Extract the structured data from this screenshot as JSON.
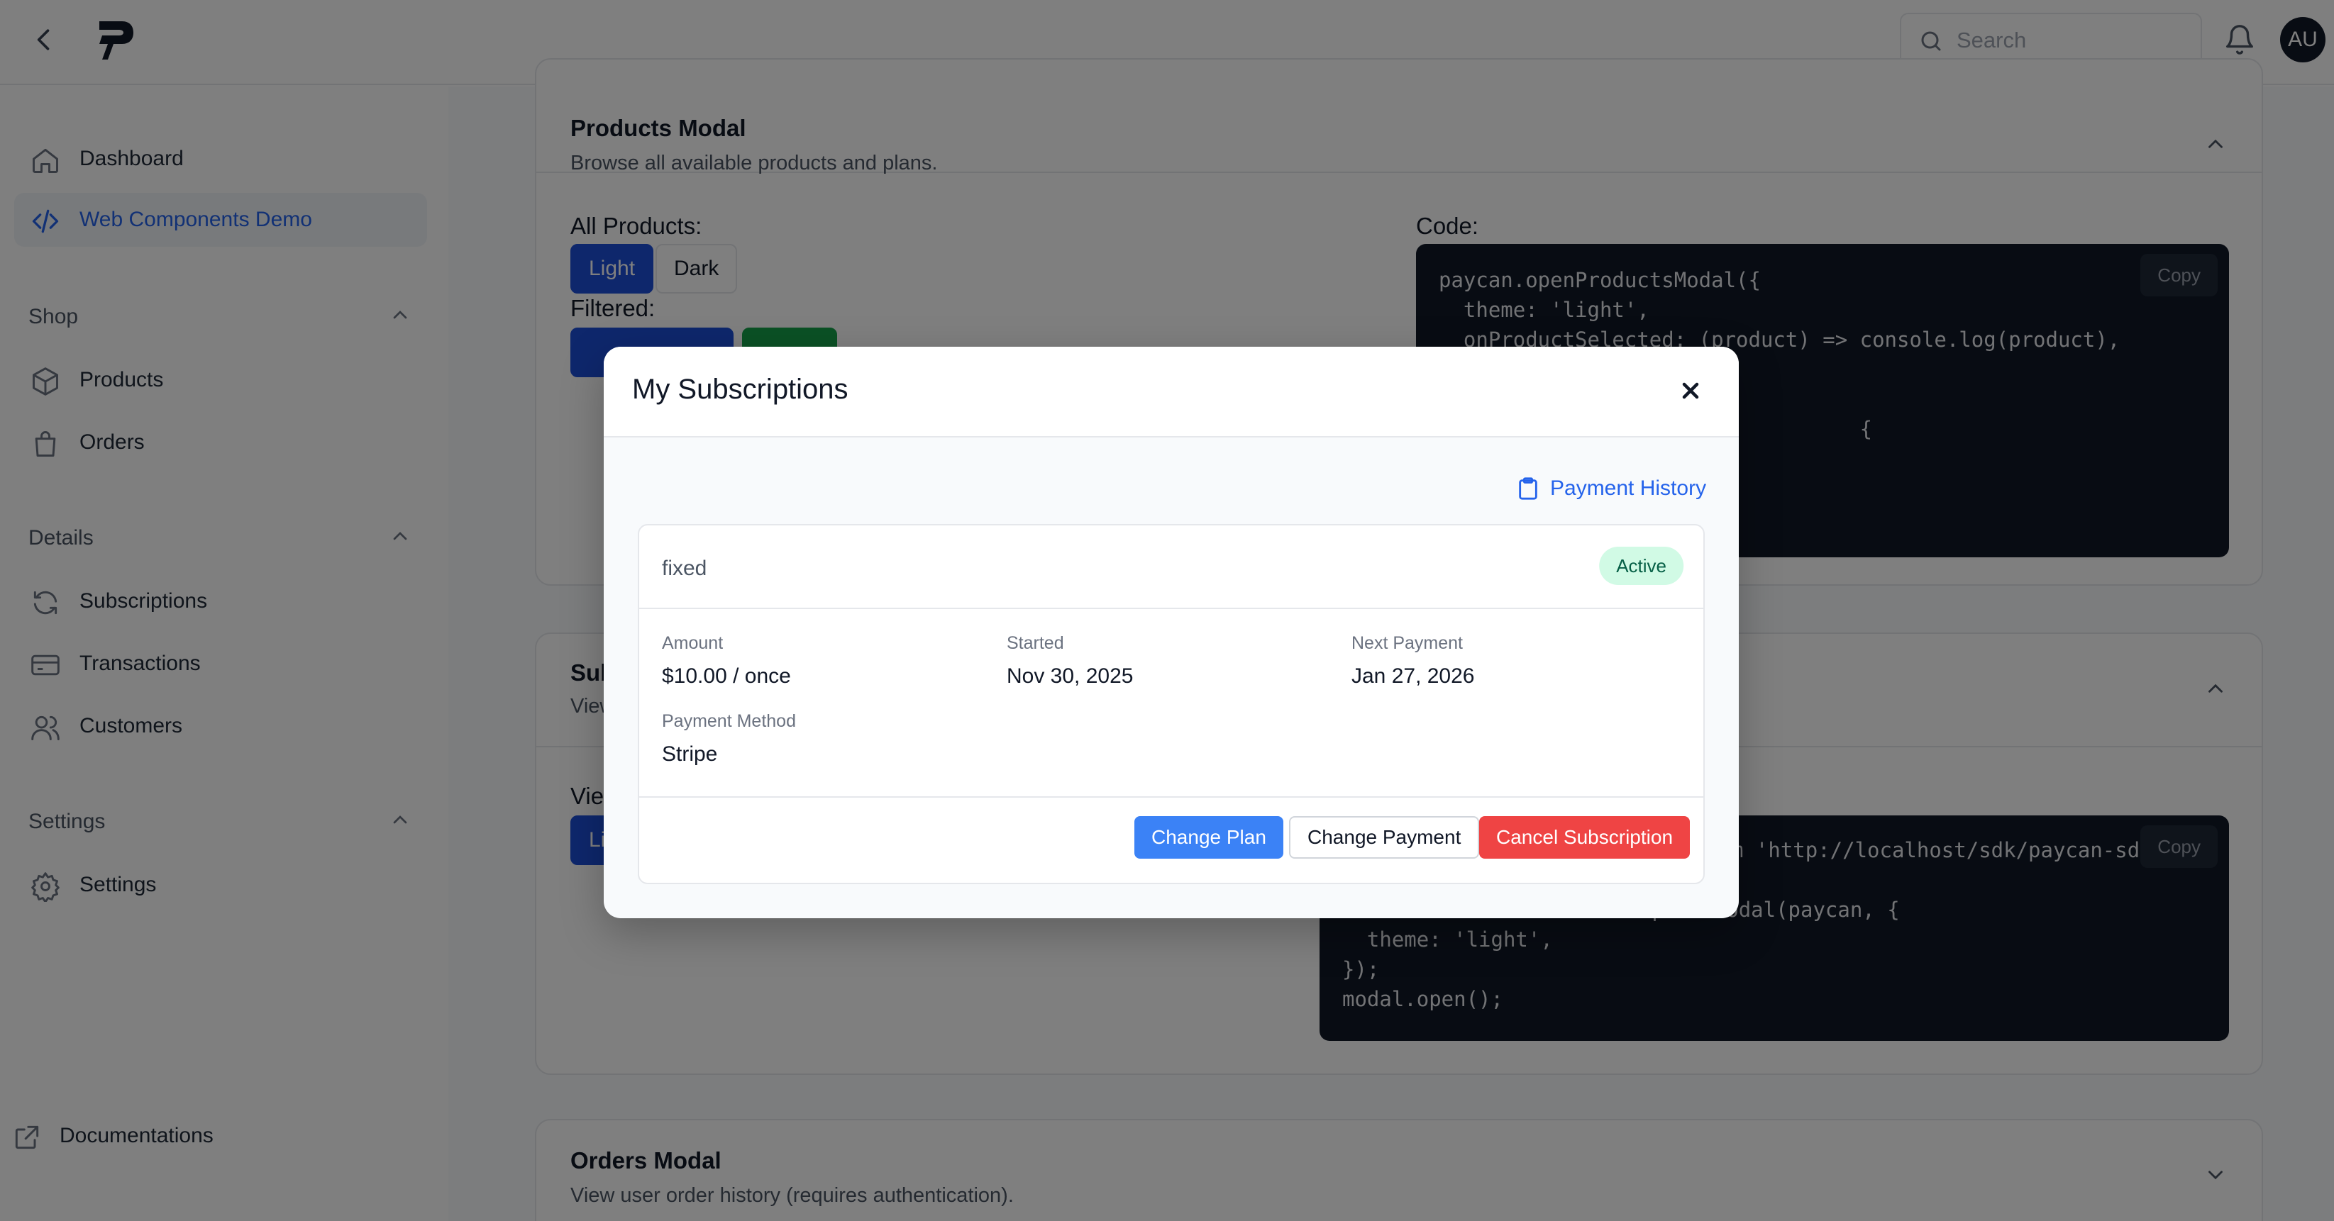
{
  "header": {
    "search_placeholder": "Search",
    "avatar_initials": "AU"
  },
  "sidebar": {
    "items_top": [
      {
        "label": "Dashboard",
        "icon": "home-icon"
      },
      {
        "label": "Web Components Demo",
        "icon": "code-icon",
        "active": true
      }
    ],
    "groups": [
      {
        "title": "Shop",
        "items": [
          {
            "label": "Products",
            "icon": "box-icon"
          },
          {
            "label": "Orders",
            "icon": "shopping-bag-icon"
          }
        ]
      },
      {
        "title": "Details",
        "items": [
          {
            "label": "Subscriptions",
            "icon": "refresh-icon"
          },
          {
            "label": "Transactions",
            "icon": "credit-card-icon"
          },
          {
            "label": "Customers",
            "icon": "users-icon"
          }
        ]
      },
      {
        "title": "Settings",
        "items": [
          {
            "label": "Settings",
            "icon": "gear-icon"
          }
        ]
      }
    ],
    "footer_item": {
      "label": "Documentations",
      "icon": "external-link-icon"
    }
  },
  "main": {
    "products_card": {
      "title": "Products Modal",
      "description": "Browse all available products and plans.",
      "all_products_label": "All Products:",
      "theme_light": "Light",
      "theme_dark": "Dark",
      "filtered_label": "Filtered:",
      "code_label": "Code:",
      "copy_label": "Copy",
      "code": "paycan.openProductsModal({\n  theme: 'light',\n  onProductSelected: (product) => console.log(product),\n\n\n                                  {"
    },
    "subscriptions_card": {
      "title_partial": "Sub",
      "desc_partial": "View",
      "view_label_partial": "Vie",
      "btn_partial": "Li",
      "copy_label": "Copy",
      "code_line1": "m 'http://localhost/sdk/paycan-sdk",
      "code": "const modal = new SubscriptionModal(paycan, {\n  theme: 'light',\n});\nmodal.open();"
    },
    "orders_card": {
      "title": "Orders Modal",
      "description": "View user order history (requires authentication)."
    }
  },
  "modal": {
    "title": "My Subscriptions",
    "payment_history": "Payment History",
    "subscription": {
      "name": "fixed",
      "status": "Active",
      "amount_label": "Amount",
      "amount_value": "$10.00 / once",
      "started_label": "Started",
      "started_value": "Nov 30, 2025",
      "next_payment_label": "Next Payment",
      "next_payment_value": "Jan 27, 2026",
      "payment_method_label": "Payment Method",
      "payment_method_value": "Stripe"
    },
    "buttons": {
      "change_plan": "Change Plan",
      "change_payment": "Change Payment",
      "cancel_subscription": "Cancel Subscription"
    }
  },
  "colors": {
    "accent": "#2563eb",
    "primary_button": "#3b82f6",
    "danger_button": "#ef4444",
    "active_badge_bg": "#d1fae5",
    "active_badge_text": "#065f46"
  }
}
